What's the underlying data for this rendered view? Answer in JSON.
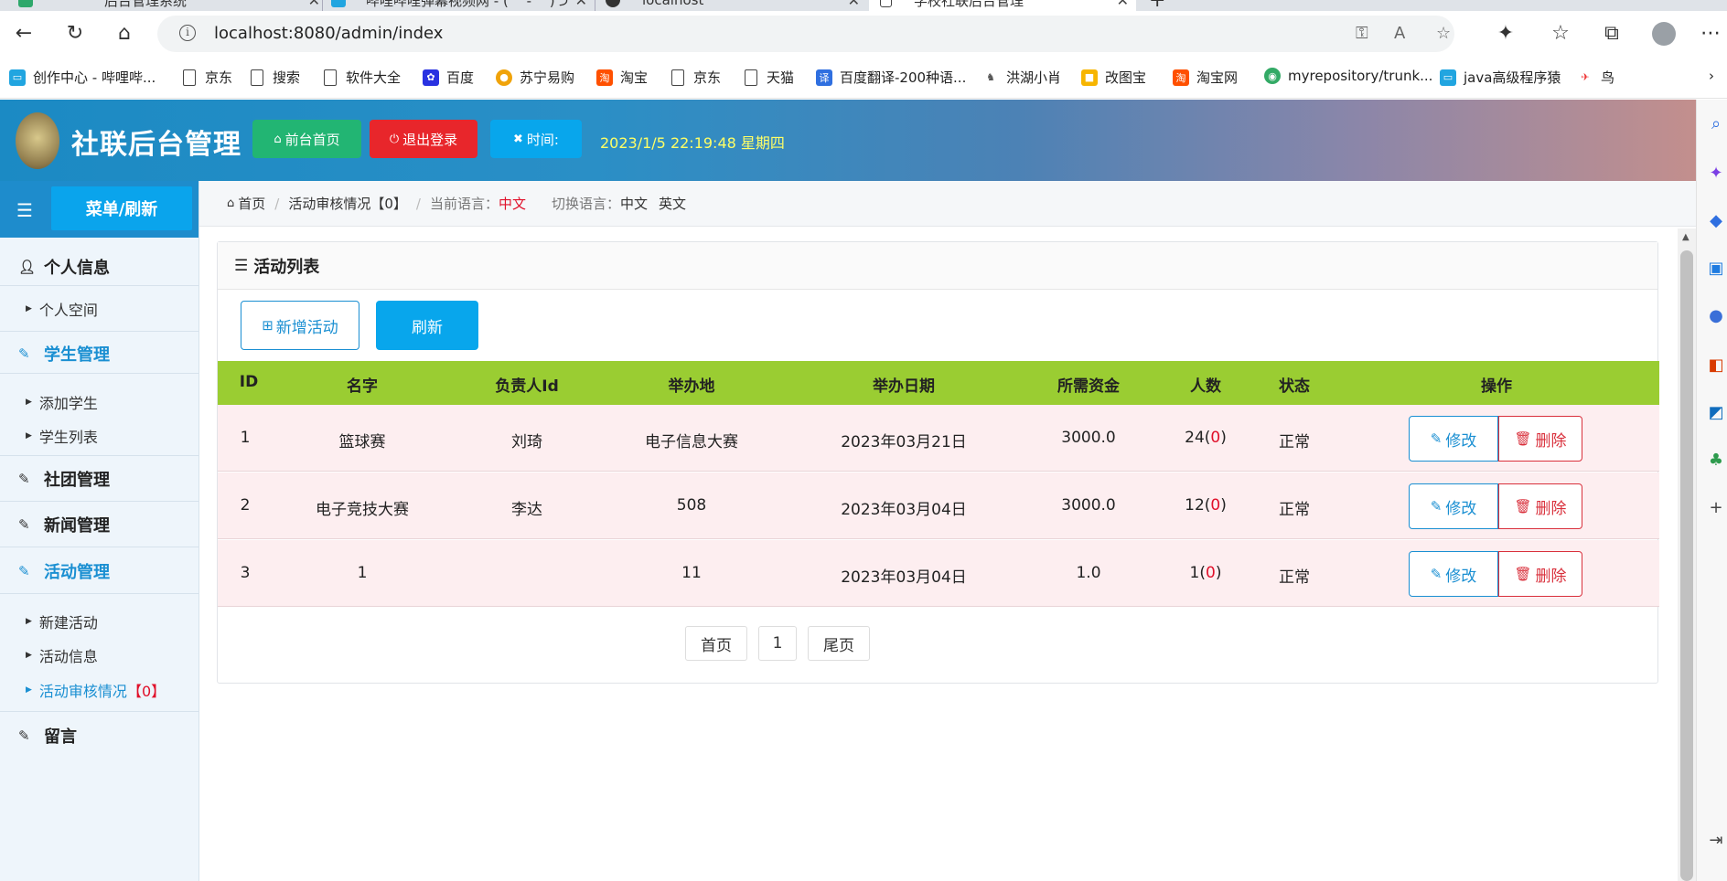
{
  "browser": {
    "tabs": [
      {
        "title": "后台管理系统",
        "active": false
      },
      {
        "title": "哔哩哔哩弹幕视频网 - ( ゜- ゜)つ",
        "active": false
      },
      {
        "title": "localhost",
        "active": false
      },
      {
        "title": "学校社联后台管理",
        "active": true
      }
    ],
    "url": "localhost:8080/admin/index",
    "bookmarks": [
      "创作中心 - 哔哩哔...",
      "京东",
      "搜索",
      "软件大全",
      "百度",
      "苏宁易购",
      "淘宝",
      "京东",
      "天猫",
      "百度翻译-200种语...",
      "洪湖小肖",
      "改图宝",
      "淘宝网",
      "myrepository/trunk...",
      "java高级程序猿",
      "鸟"
    ]
  },
  "header": {
    "title": "社联后台管理",
    "btn_home": "前台首页",
    "btn_logout": "退出登录",
    "btn_time": "时间:",
    "clock": "2023/1/5 22:19:48 星期四",
    "colors": {
      "green": "#22b573",
      "red": "#e8262b",
      "blue": "#08a6ec"
    }
  },
  "sidebar": {
    "menu_label": "菜单/刷新",
    "sections": [
      {
        "label": "个人信息",
        "icon": "user-icon",
        "items": [
          "个人空间"
        ]
      },
      {
        "label": "学生管理",
        "icon": "edit-icon",
        "items": [
          "添加学生",
          "学生列表"
        ]
      },
      {
        "label": "社团管理",
        "icon": "edit-icon",
        "items": []
      },
      {
        "label": "新闻管理",
        "icon": "edit-icon",
        "items": []
      },
      {
        "label": "活动管理",
        "icon": "edit-icon",
        "items": [
          "新建活动",
          "活动信息",
          "活动审核情况"
        ]
      },
      {
        "label": "留言",
        "icon": "edit-icon",
        "items": []
      }
    ],
    "audit_badge": "【0】"
  },
  "breadcrumb": {
    "home": "首页",
    "current": "活动审核情况【0】",
    "lang_label": "当前语言：",
    "lang_value": "中文",
    "switch_label": "切换语言：",
    "lang_zh": "中文",
    "lang_en": "英文"
  },
  "panel": {
    "title": "活动列表",
    "btn_add": "新增活动",
    "btn_refresh": "刷新",
    "columns": [
      "ID",
      "名字",
      "负责人Id",
      "举办地",
      "举办日期",
      "所需资金",
      "人数",
      "状态",
      "操作"
    ],
    "rows": [
      {
        "id": "1",
        "name": "篮球赛",
        "leader": "刘琦",
        "place": "电子信息大赛",
        "date": "2023年03月21日",
        "fund": "3000.0",
        "count": "24",
        "count_extra": "0",
        "status": "正常"
      },
      {
        "id": "2",
        "name": "电子竞技大赛",
        "leader": "李达",
        "place": "508",
        "date": "2023年03月04日",
        "fund": "3000.0",
        "count": "12",
        "count_extra": "0",
        "status": "正常"
      },
      {
        "id": "3",
        "name": "1",
        "leader": "",
        "place": "11",
        "date": "2023年03月04日",
        "fund": "1.0",
        "count": "1",
        "count_extra": "0",
        "status": "正常"
      }
    ],
    "action_edit": "修改",
    "action_delete": "删除",
    "pager": {
      "first": "首页",
      "page": "1",
      "last": "尾页"
    }
  }
}
